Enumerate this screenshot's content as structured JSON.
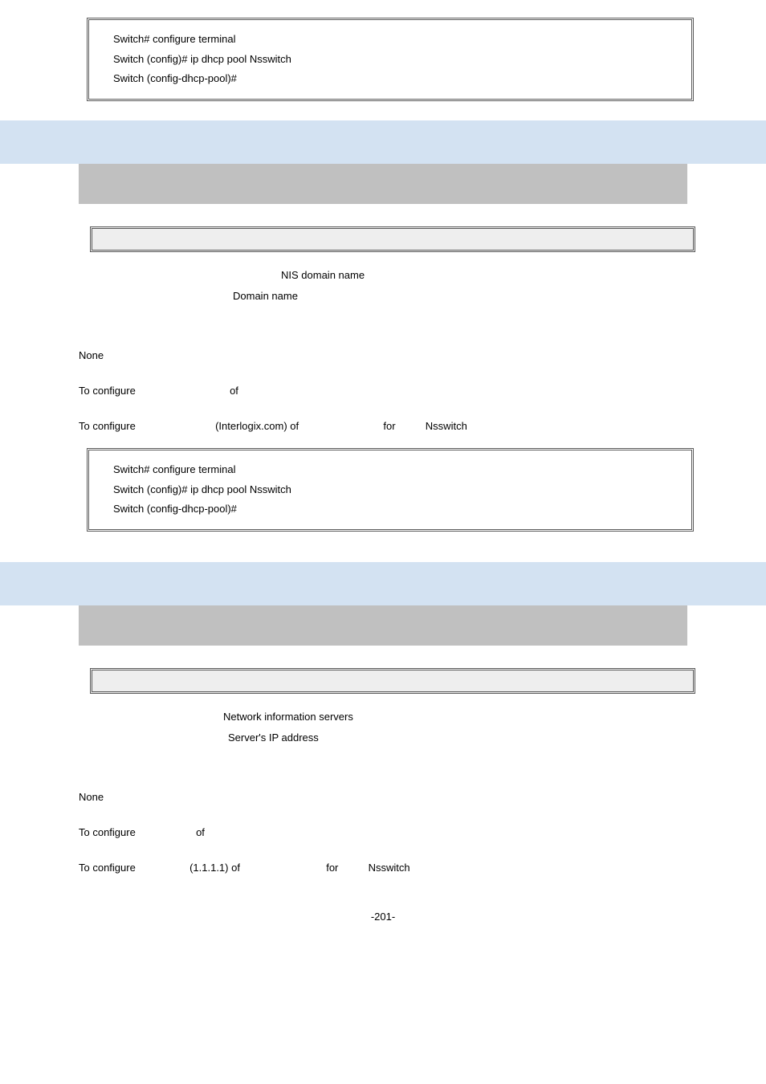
{
  "code1": {
    "l1": "Switch# configure terminal",
    "l2": "Switch (config)# ip dhcp pool Nsswitch",
    "l3": "Switch (config-dhcp-pool)#"
  },
  "sec1": {
    "desc_l1": "NIS domain name",
    "desc_l2": "Domain name",
    "default_val": "None",
    "usage_prefix": "To configure",
    "usage_mid": "of",
    "ex_pre": "To configure",
    "ex_domain": "(Interlogix.com) of",
    "ex_for": "for",
    "ex_pool": "Nsswitch",
    "code_l1": "Switch# configure terminal",
    "code_l2": "Switch (config)# ip dhcp pool Nsswitch",
    "code_l3": "Switch (config-dhcp-pool)#"
  },
  "sec2": {
    "desc_l1": "Network information servers",
    "desc_l2": "Server's IP address",
    "default_val": "None",
    "usage_prefix": "To configure",
    "usage_mid": "of",
    "ex_pre": "To configure",
    "ex_ip": "(1.1.1.1) of",
    "ex_for": "for",
    "ex_pool": "Nsswitch"
  },
  "pagenum": "-201-"
}
